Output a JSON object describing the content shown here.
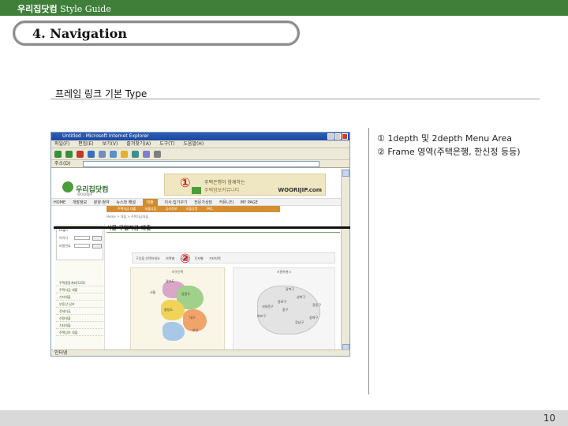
{
  "header": {
    "brand_korean": "우리집닷컴",
    "brand_suffix": "Style Guide"
  },
  "section": {
    "title": "4. Navigation"
  },
  "subheading": "프레임 링크 기본 Type",
  "notes": [
    "① 1depth 및 2depth Menu Area",
    "② Frame 영역(주택은행, 한신정 등등)"
  ],
  "callouts": {
    "one": "①",
    "two": "②"
  },
  "browser": {
    "title": "Untitled - Microsoft Internet Explorer",
    "menu": [
      "파일(F)",
      "편집(E)",
      "보기(V)",
      "즐겨찾기(A)",
      "도구(T)",
      "도움말(H)"
    ],
    "address_label": "주소(D)",
    "status": "인터넷",
    "site": {
      "logo": "우리집닷컴",
      "logo_sub": "WOORIJIP",
      "banner_line1": "주택은행이 함께하는",
      "banner_line2": "주택정보커뮤니티",
      "banner_brand": "WOORIJIP.com",
      "gnb": [
        "HOME",
        "개발정보",
        "분양·청약",
        "뉴스와 해설",
        "대출",
        "이사·집가꾸기",
        "전문가상담",
        "커뮤니티",
        "MY PAGE"
      ],
      "gnb_active_index": 4,
      "lnb": [
        "주택자금 대출",
        "대출상담",
        "금리정보",
        "대출상품",
        "FAQ"
      ],
      "location": "Home > 대출 > 주택자금대출",
      "login": {
        "title": "Login",
        "id_label": "아이디",
        "pw_label": "비밀번호"
      },
      "left_menu": [
        "주택종합계좌(CSS)",
        "주택자금 대출",
        "기타대출",
        "부동산 담보",
        "전세자금",
        "신용대출",
        "기타대출",
        "주택담보 대출"
      ],
      "content_title": "서울 구입자금 대출",
      "region_bar": {
        "label": "구입을 선택하세요",
        "tabs": [
          "지역별",
          "시세별",
          "단지별",
          "기타지역"
        ]
      },
      "map_left_caption": "지역선택",
      "map_right_caption": "서울특별시",
      "map_left_labels": [
        "경기도",
        "서울",
        "강원도",
        "충청도",
        "대구",
        "부산"
      ],
      "map_right_labels": [
        "강북구",
        "성북구",
        "종로구",
        "중구",
        "서대문구",
        "마포구",
        "강남구",
        "송파구",
        "강동구"
      ]
    }
  },
  "footer": {
    "page_number": "10"
  },
  "colors": {
    "topbar": "#3f7f3a",
    "accent_orange": "#d58f32",
    "callout_red": "#d02020"
  }
}
